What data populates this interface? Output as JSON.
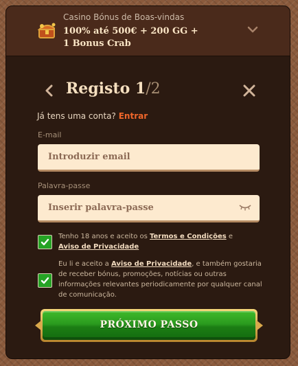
{
  "banner": {
    "subtitle": "Casino Bónus de Boas-vindas",
    "title": "100% até 500€ + 200 GG + 1 Bonus Crab"
  },
  "form": {
    "title": "Registo",
    "step_current": "1",
    "step_total": "/2"
  },
  "login": {
    "prompt": "Já tens uma conta?",
    "link": "Entrar"
  },
  "fields": {
    "email": {
      "label": "E-mail",
      "placeholder": "Introduzir email",
      "value": ""
    },
    "password": {
      "label": "Palavra-passe",
      "placeholder": "Inserir palavra-passe",
      "value": ""
    }
  },
  "consents": {
    "terms": {
      "checked": true,
      "text_before": "Tenho 18 anos e aceito os ",
      "terms_link": "Termos e Condições",
      "text_and": " e ",
      "privacy_link": "Aviso de Privacidade"
    },
    "marketing": {
      "checked": true,
      "text_before": "Eu li e aceito a ",
      "privacy_link": "Aviso de Privacidade",
      "text_after": ", e também gostaria de receber bónus, promoções, notícias ou outras informações relevantes periodicamente por qualquer canal de comunicação."
    }
  },
  "buttons": {
    "next": "PRÓXIMO PASSO"
  },
  "colors": {
    "accent": "#f0662a",
    "modal_bg": "#2b1a11",
    "checkbox": "#25a325",
    "button": "#2a9a1e"
  },
  "icons": [
    "treasure-chest-icon",
    "chevron-down-icon",
    "chevron-left-icon",
    "close-icon",
    "eye-closed-icon",
    "checkmark-icon"
  ]
}
